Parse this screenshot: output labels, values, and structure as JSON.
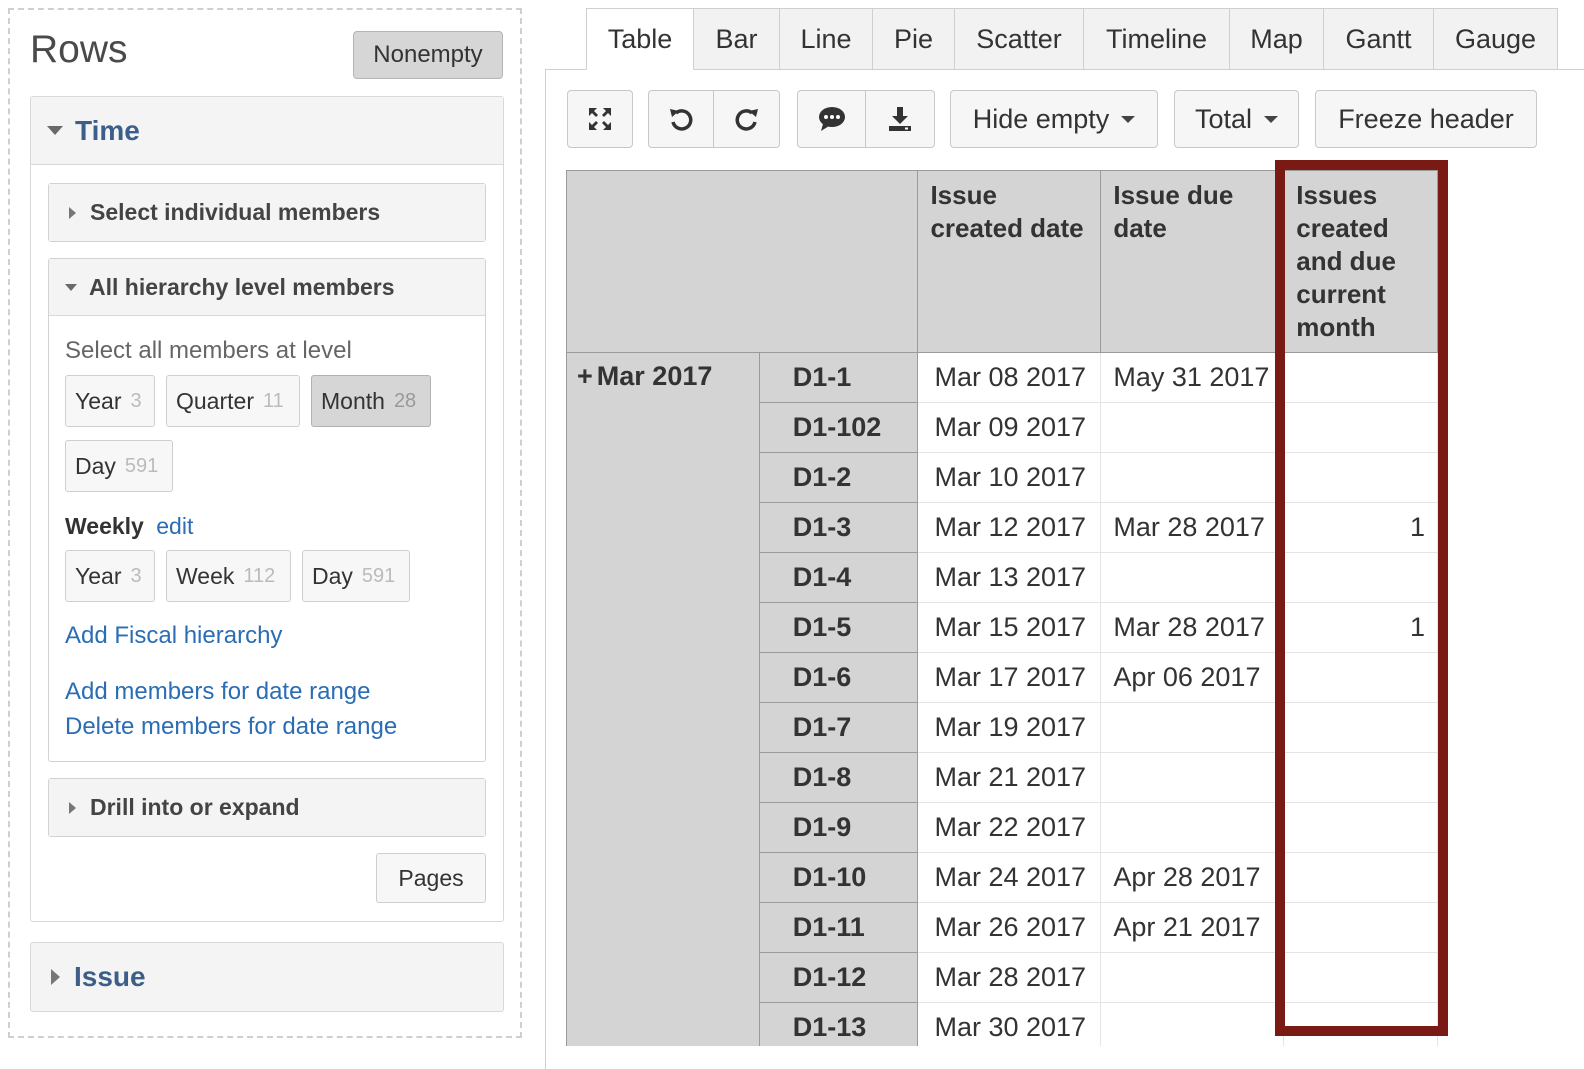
{
  "left": {
    "title": "Rows",
    "nonempty_label": "Nonempty",
    "time_section": {
      "title": "Time",
      "select_individual": "Select individual members",
      "all_hierarchy": {
        "title": "All hierarchy level members",
        "select_level_label": "Select all members at level",
        "levels": [
          {
            "label": "Year",
            "count": "3"
          },
          {
            "label": "Quarter",
            "count": "11"
          },
          {
            "label": "Month",
            "count": "28"
          },
          {
            "label": "Day",
            "count": "591"
          }
        ],
        "weekly_label": "Weekly",
        "weekly_edit": "edit",
        "weekly_levels": [
          {
            "label": "Year",
            "count": "3"
          },
          {
            "label": "Week",
            "count": "112"
          },
          {
            "label": "Day",
            "count": "591"
          }
        ],
        "add_fiscal": "Add Fiscal hierarchy",
        "add_range": "Add members for date range",
        "delete_range": "Delete members for date range"
      },
      "drill": "Drill into or expand",
      "pages_label": "Pages"
    },
    "issue_section": {
      "title": "Issue"
    }
  },
  "tabs": [
    "Table",
    "Bar",
    "Line",
    "Pie",
    "Scatter",
    "Timeline",
    "Map",
    "Gantt",
    "Gauge"
  ],
  "active_tab": "Table",
  "toolbar": {
    "icons": [
      "fullscreen-icon",
      "undo-icon",
      "redo-icon",
      "comment-icon",
      "download-icon"
    ],
    "hide_empty": "Hide empty",
    "total": "Total",
    "freeze_header": "Freeze header"
  },
  "table": {
    "headers": [
      "Issue created date",
      "Issue due date",
      "Issues created and due current month"
    ],
    "month": "Mar 2017",
    "rows": [
      {
        "issue": "D1-1",
        "created": "Mar 08 2017",
        "due": "May 31 2017",
        "value": ""
      },
      {
        "issue": "D1-102",
        "created": "Mar 09 2017",
        "due": "",
        "value": ""
      },
      {
        "issue": "D1-2",
        "created": "Mar 10 2017",
        "due": "",
        "value": ""
      },
      {
        "issue": "D1-3",
        "created": "Mar 12 2017",
        "due": "Mar 28 2017",
        "value": "1"
      },
      {
        "issue": "D1-4",
        "created": "Mar 13 2017",
        "due": "",
        "value": ""
      },
      {
        "issue": "D1-5",
        "created": "Mar 15 2017",
        "due": "Mar 28 2017",
        "value": "1"
      },
      {
        "issue": "D1-6",
        "created": "Mar 17 2017",
        "due": "Apr 06 2017",
        "value": ""
      },
      {
        "issue": "D1-7",
        "created": "Mar 19 2017",
        "due": "",
        "value": ""
      },
      {
        "issue": "D1-8",
        "created": "Mar 21 2017",
        "due": "",
        "value": ""
      },
      {
        "issue": "D1-9",
        "created": "Mar 22 2017",
        "due": "",
        "value": ""
      },
      {
        "issue": "D1-10",
        "created": "Mar 24 2017",
        "due": "Apr 28 2017",
        "value": ""
      },
      {
        "issue": "D1-11",
        "created": "Mar 26 2017",
        "due": "Apr 21 2017",
        "value": ""
      },
      {
        "issue": "D1-12",
        "created": "Mar 28 2017",
        "due": "",
        "value": ""
      },
      {
        "issue": "D1-13",
        "created": "Mar 30 2017",
        "due": "",
        "value": ""
      }
    ],
    "highlight_color": "#7a1a14"
  }
}
